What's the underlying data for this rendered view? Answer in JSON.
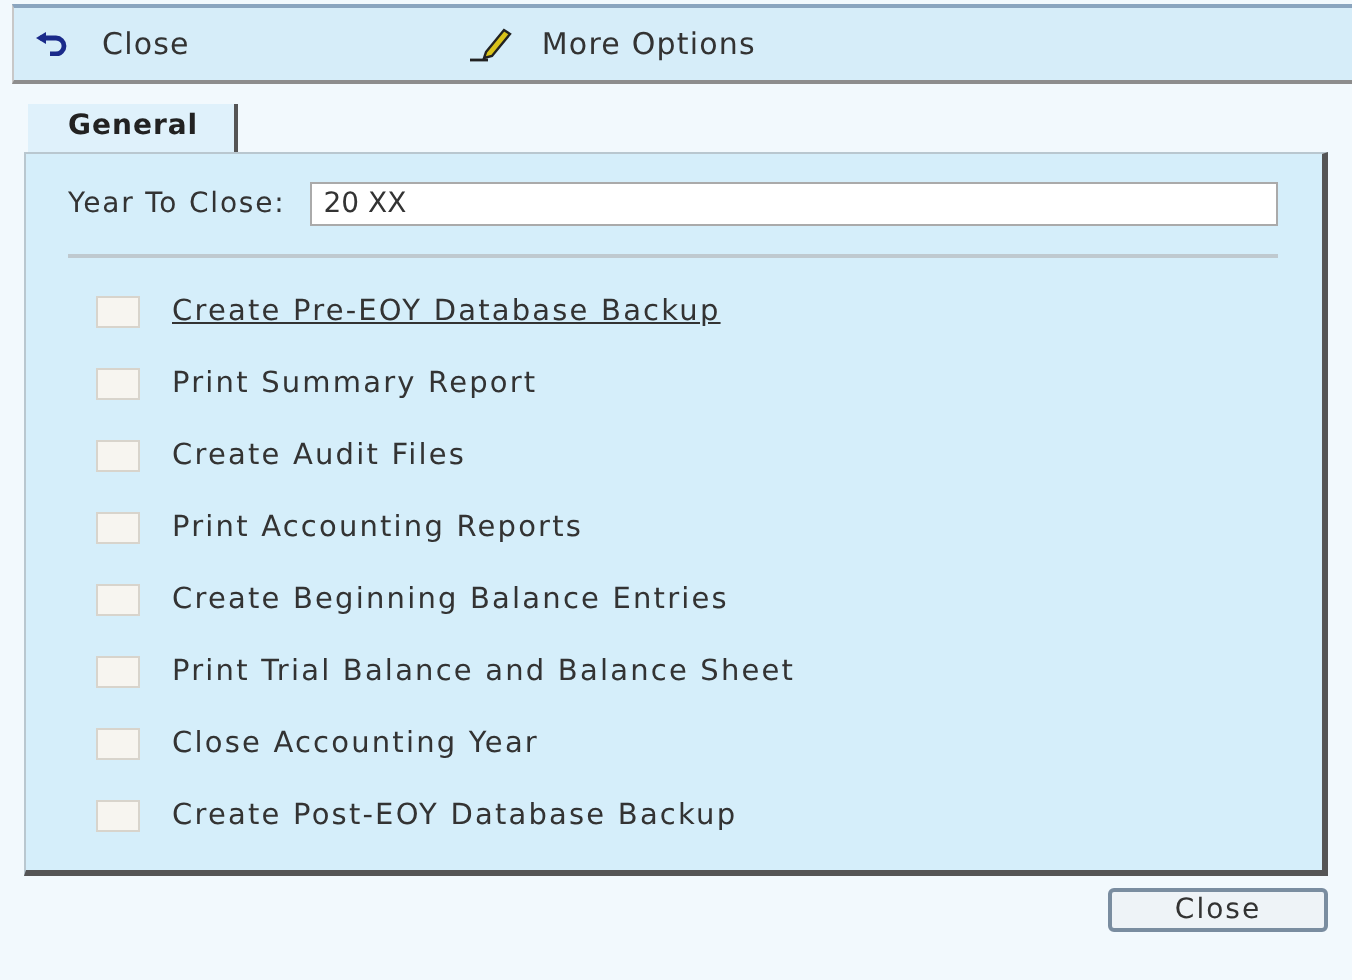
{
  "toolbar": [
    {
      "kind": "undo",
      "label": "Close"
    },
    {
      "kind": "pencil",
      "label": "More Options"
    }
  ],
  "tabs": [
    {
      "label": "General",
      "selected": true
    }
  ],
  "year_field": {
    "label": "Year To Close:",
    "value": "20 XX"
  },
  "tasks": [
    {
      "label": "Create Pre-EOY Database Backup",
      "checked": false,
      "focused": true
    },
    {
      "label": "Print Summary Report",
      "checked": false,
      "focused": false
    },
    {
      "label": "Create Audit Files",
      "checked": false,
      "focused": false
    },
    {
      "label": "Print Accounting Reports",
      "checked": false,
      "focused": false
    },
    {
      "label": "Create Beginning Balance Entries",
      "checked": false,
      "focused": false
    },
    {
      "label": "Print Trial Balance and Balance Sheet",
      "checked": false,
      "focused": false
    },
    {
      "label": "Close Accounting Year",
      "checked": false,
      "focused": false
    },
    {
      "label": "Create Post-EOY Database Backup",
      "checked": false,
      "focused": false
    }
  ],
  "buttons": [
    {
      "label": "Close"
    }
  ]
}
